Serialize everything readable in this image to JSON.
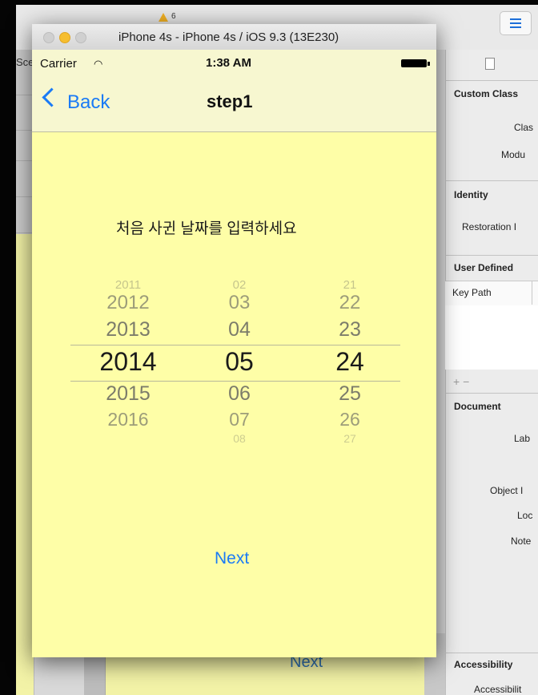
{
  "xcode": {
    "scene_tab": "Sce",
    "warning_count": "6",
    "storyboard_next": "Next",
    "inspector": {
      "custom_class_header": "Custom Class",
      "class_label": "Clas",
      "module_label": "Modu",
      "identity_header": "Identity",
      "restoration_label": "Restoration I",
      "user_defined_header": "User Defined",
      "key_path_label": "Key Path",
      "add_remove": "+ −",
      "document_header": "Document",
      "label_label": "Lab",
      "object_label": "Object I",
      "lock_label": "Loc",
      "notes_label": "Note",
      "accessibility_header": "Accessibility",
      "accessibility_label": "Accessibilit"
    }
  },
  "simulator": {
    "window_title": "iPhone 4s - iPhone 4s / iOS 9.3 (13E230)",
    "status": {
      "carrier": "Carrier",
      "wifi": "wifi-icon",
      "time": "1:38 AM",
      "battery": "battery-icon"
    },
    "nav": {
      "back_label": "Back",
      "title": "step1"
    },
    "prompt": "처음 사귄 날짜를 입력하세요",
    "picker": {
      "years": [
        "2011",
        "2012",
        "2013",
        "2014",
        "2015",
        "2016"
      ],
      "months": [
        "02",
        "03",
        "04",
        "05",
        "06",
        "07",
        "08"
      ],
      "days": [
        "21",
        "22",
        "23",
        "24",
        "25",
        "26",
        "27"
      ],
      "selected": {
        "year": "2014",
        "month": "05",
        "day": "24"
      }
    },
    "next_label": "Next"
  },
  "colors": {
    "accent": "#1b7bf5",
    "screen_bg": "#fefea7",
    "bar_bg": "#f7f7d0"
  }
}
